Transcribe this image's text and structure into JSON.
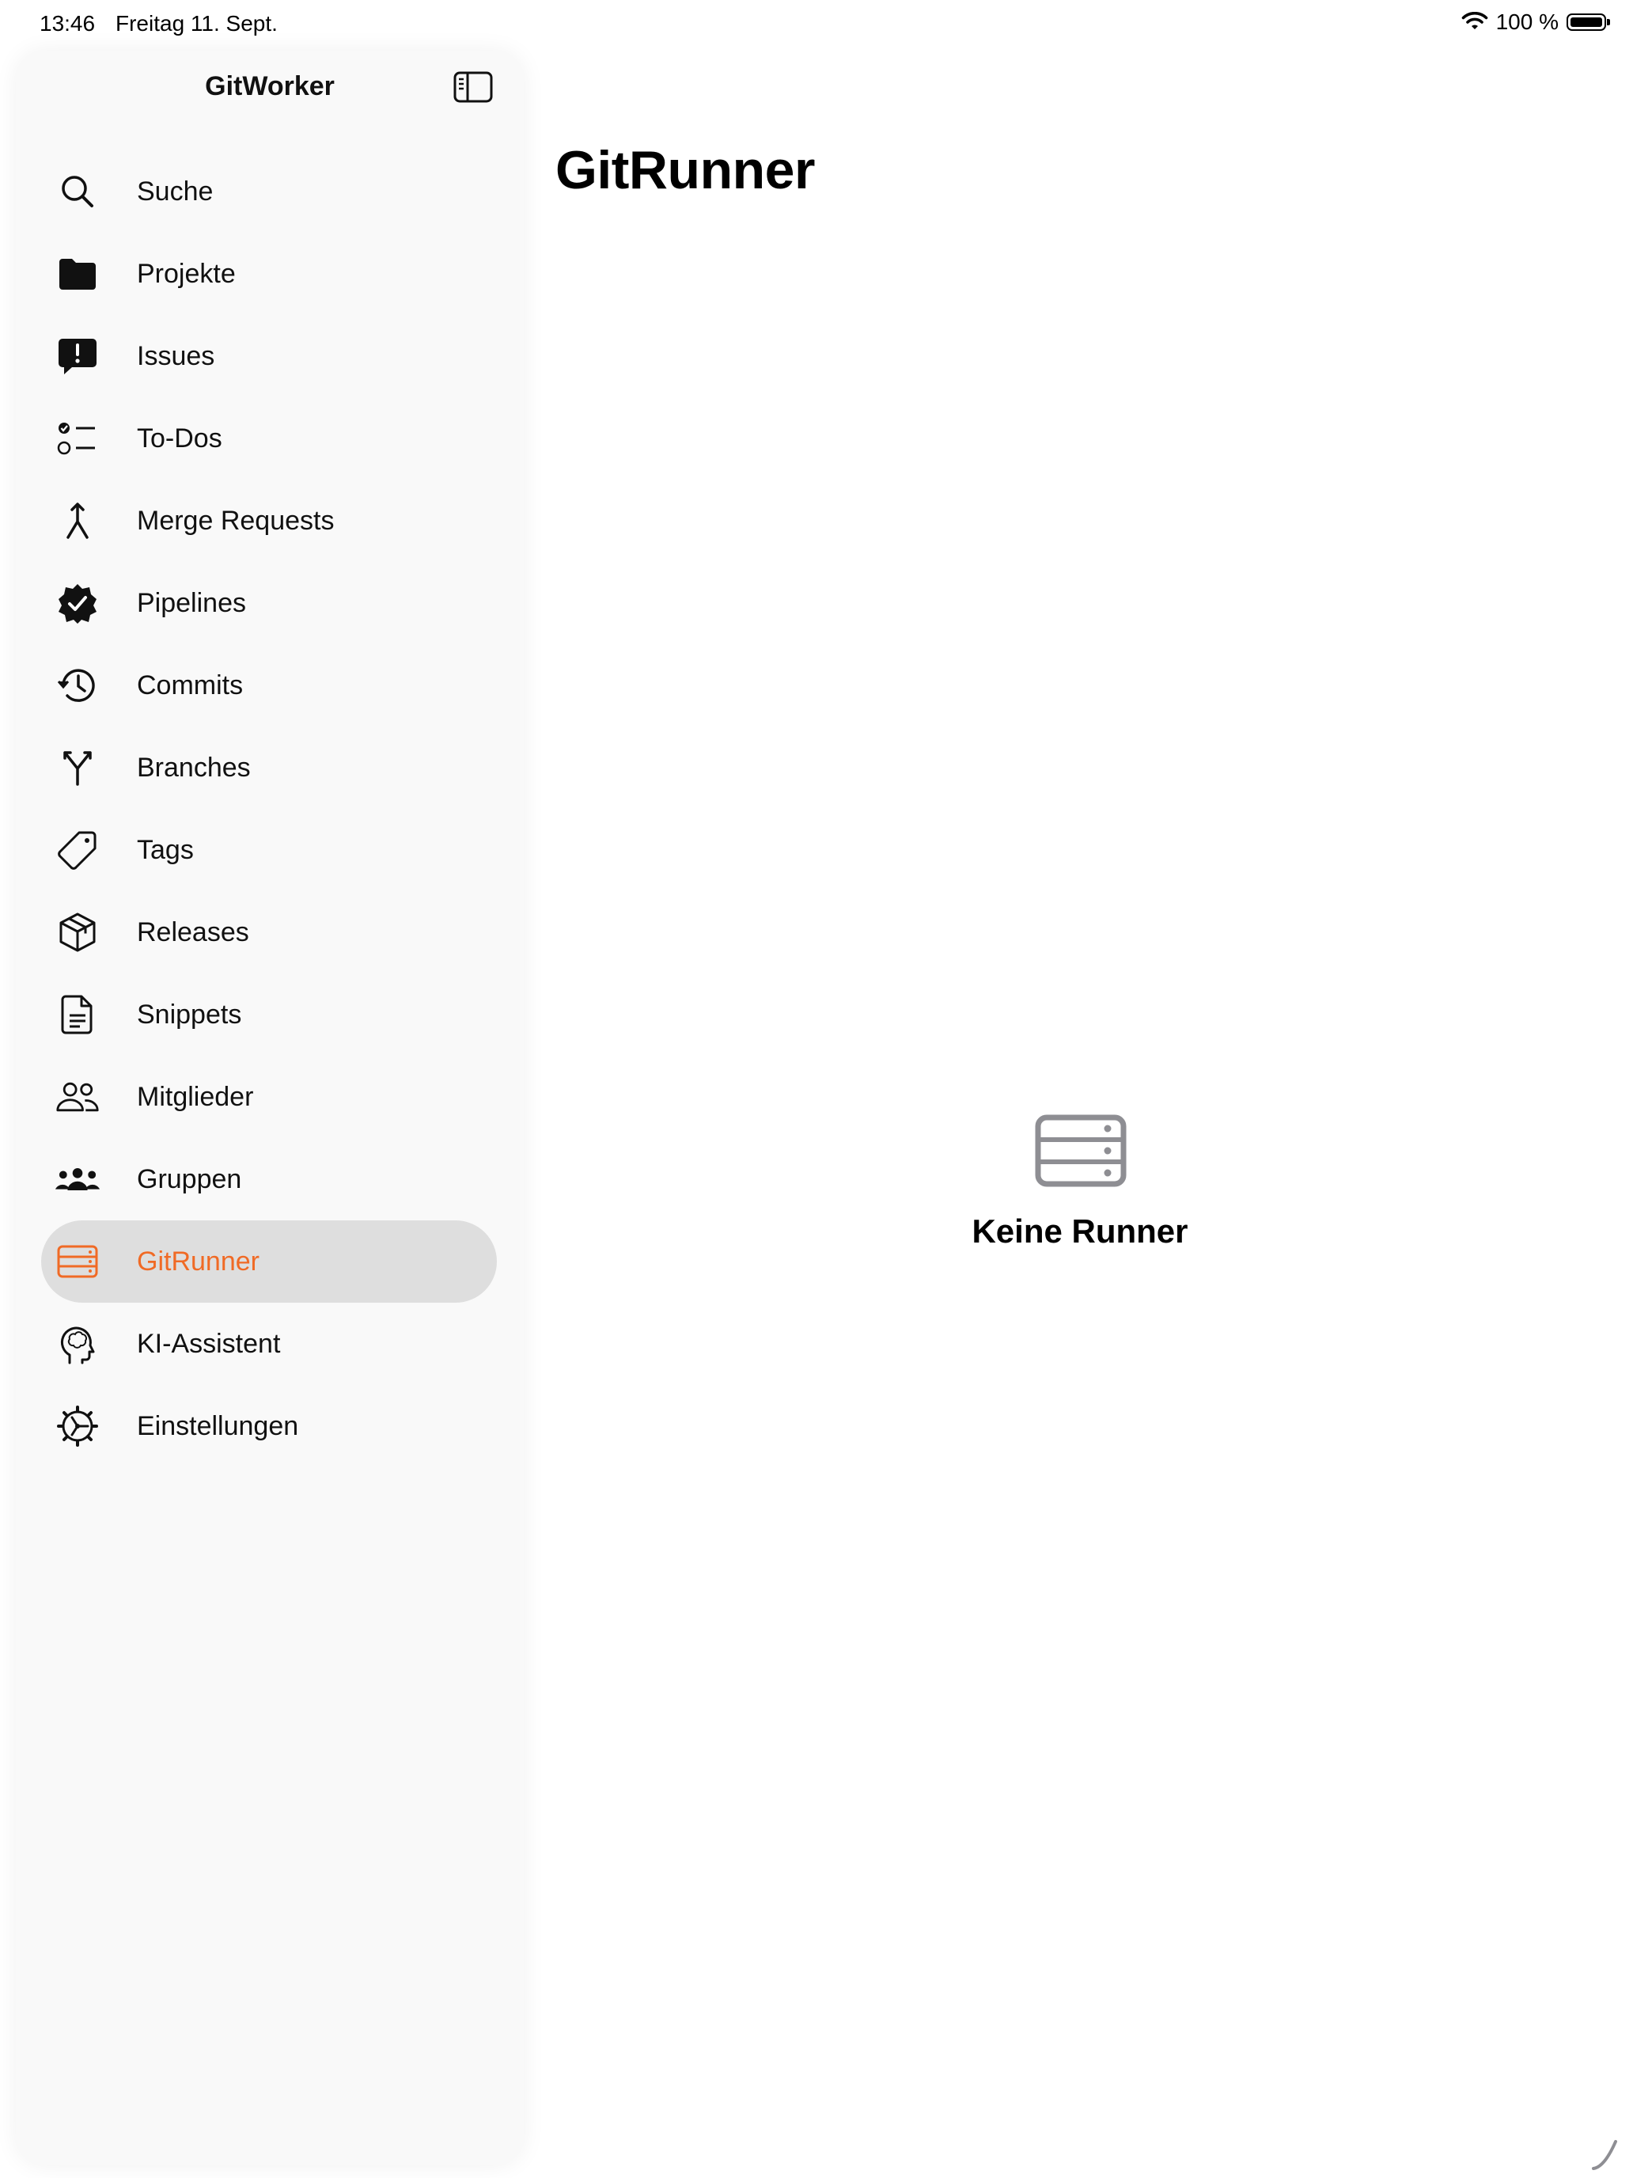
{
  "status_bar": {
    "time": "13:46",
    "date": "Freitag 11. Sept.",
    "battery_percent": "100 %",
    "battery_level": 1.0
  },
  "sidebar": {
    "title": "GitWorker",
    "toggle_icon": "sidebar-left-icon",
    "accent_color": "#f06a25",
    "items": [
      {
        "label": "Suche",
        "icon": "magnifyingglass-icon",
        "active": false
      },
      {
        "label": "Projekte",
        "icon": "folder-icon",
        "active": false
      },
      {
        "label": "Issues",
        "icon": "exclamation-bubble-icon",
        "active": false
      },
      {
        "label": "To-Dos",
        "icon": "checklist-icon",
        "active": false
      },
      {
        "label": "Merge Requests",
        "icon": "merge-icon",
        "active": false
      },
      {
        "label": "Pipelines",
        "icon": "checkmark-seal-icon",
        "active": false
      },
      {
        "label": "Commits",
        "icon": "clock-history-icon",
        "active": false
      },
      {
        "label": "Branches",
        "icon": "branch-icon",
        "active": false
      },
      {
        "label": "Tags",
        "icon": "tag-icon",
        "active": false
      },
      {
        "label": "Releases",
        "icon": "shipping-box-icon",
        "active": false
      },
      {
        "label": "Snippets",
        "icon": "document-icon",
        "active": false
      },
      {
        "label": "Mitglieder",
        "icon": "person-2-icon",
        "active": false
      },
      {
        "label": "Gruppen",
        "icon": "person-3-icon",
        "active": false
      },
      {
        "label": "GitRunner",
        "icon": "server-rack-icon",
        "active": true
      },
      {
        "label": "KI-Assistent",
        "icon": "brain-head-icon",
        "active": false
      },
      {
        "label": "Einstellungen",
        "icon": "gear-icon",
        "active": false
      }
    ]
  },
  "main": {
    "title": "GitRunner",
    "empty_state": {
      "icon": "server-rack-icon",
      "text": "Keine Runner"
    }
  }
}
